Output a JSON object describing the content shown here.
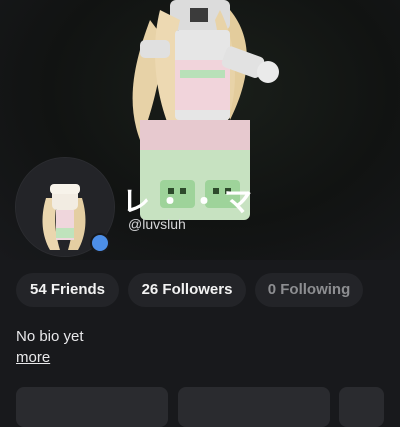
{
  "profile": {
    "display_name": "レ・・マ",
    "username": "@luvsluh",
    "online_status_color": "#4d8fe8"
  },
  "stats": {
    "friends": "54 Friends",
    "followers": "26 Followers",
    "following": "0 Following"
  },
  "bio": {
    "text": "No bio yet",
    "more_label": "more"
  },
  "colors": {
    "background": "#18191c",
    "pill_background": "#232428",
    "muted_text": "#8d8e91"
  },
  "icons": {
    "status": "online-status-dot"
  }
}
